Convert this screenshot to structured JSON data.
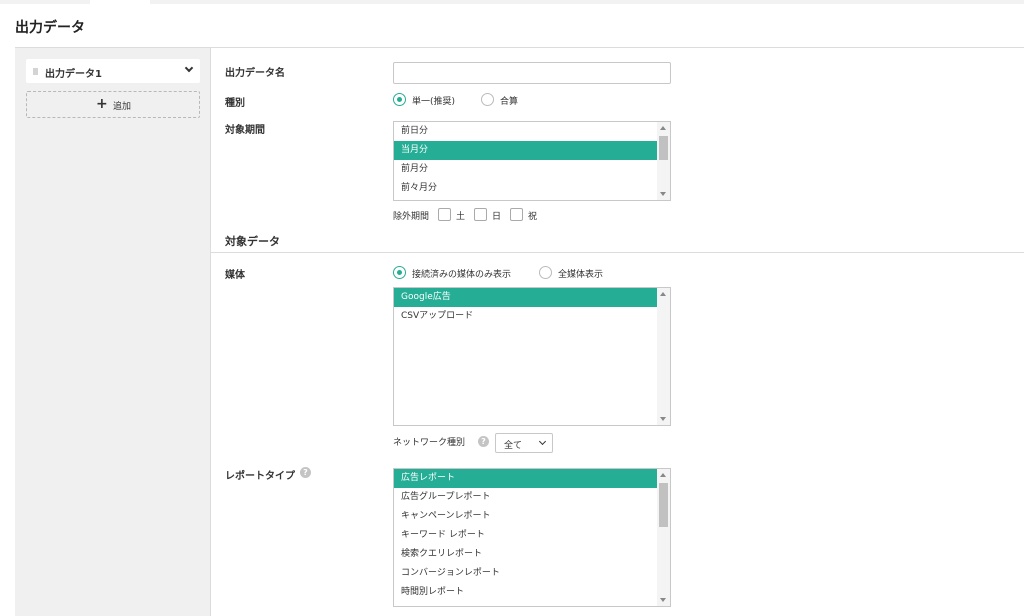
{
  "page": {
    "title": "出力データ"
  },
  "sidebar": {
    "item_label": "出力データ1",
    "add_label": "追加"
  },
  "form": {
    "name_label": "出力データ名",
    "name_value": "",
    "type_label": "種別",
    "type_options": [
      {
        "label": "単一(推奨)",
        "selected": true
      },
      {
        "label": "合算",
        "selected": false
      }
    ],
    "period_label": "対象期間",
    "period_options": [
      {
        "label": "前日分",
        "selected": false
      },
      {
        "label": "当月分",
        "selected": true
      },
      {
        "label": "前月分",
        "selected": false
      },
      {
        "label": "前々月分",
        "selected": false
      }
    ],
    "exclude_label": "除外期間",
    "exclude_options": [
      {
        "label": "土",
        "checked": false
      },
      {
        "label": "日",
        "checked": false
      },
      {
        "label": "祝",
        "checked": false
      }
    ]
  },
  "target": {
    "section_title": "対象データ",
    "media_label": "媒体",
    "media_filter_options": [
      {
        "label": "接続済みの媒体のみ表示",
        "selected": true
      },
      {
        "label": "全媒体表示",
        "selected": false
      }
    ],
    "media_options": [
      {
        "label": "Google広告",
        "selected": true
      },
      {
        "label": "CSVアップロード",
        "selected": false
      }
    ],
    "network_label": "ネットワーク種別",
    "network_value": "全て",
    "report_label": "レポートタイプ",
    "report_options": [
      {
        "label": "広告レポート",
        "selected": true
      },
      {
        "label": "広告グループレポート",
        "selected": false
      },
      {
        "label": "キャンペーンレポート",
        "selected": false
      },
      {
        "label": "キーワード レポート",
        "selected": false
      },
      {
        "label": "検索クエリレポート",
        "selected": false
      },
      {
        "label": "コンバージョンレポート",
        "selected": false
      },
      {
        "label": "時間別レポート",
        "selected": false
      }
    ]
  },
  "icons": {
    "help": "question-icon",
    "add": "plus-icon",
    "expand": "chevron-down-icon"
  },
  "colors": {
    "accent": "#26ad96"
  }
}
